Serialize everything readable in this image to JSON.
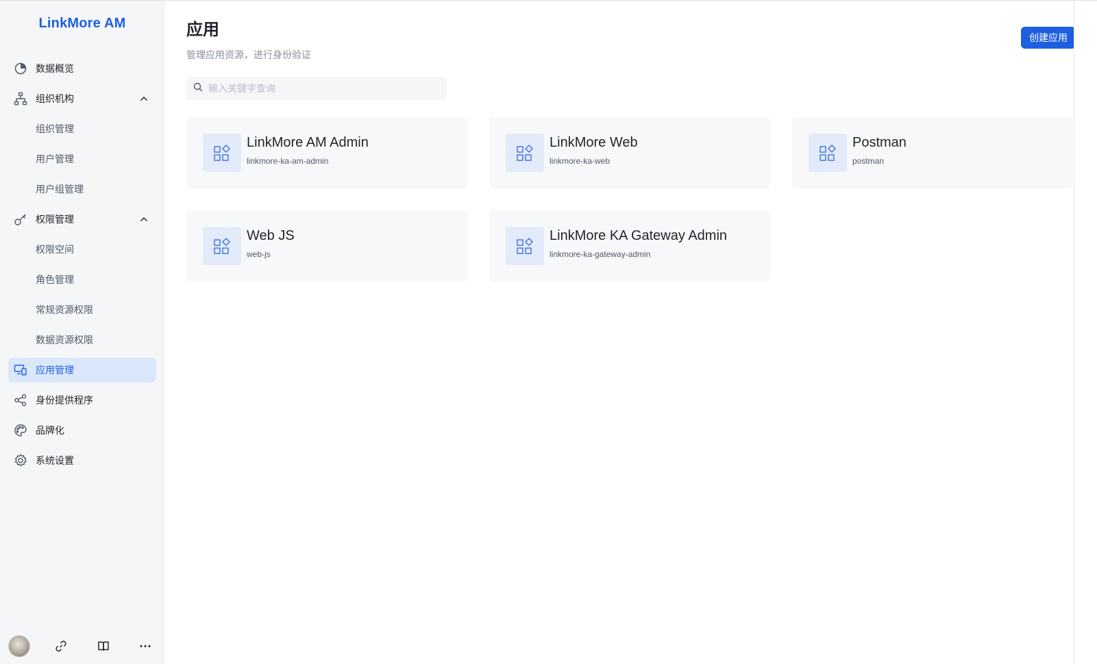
{
  "brand": "LinkMore AM",
  "nav": [
    {
      "label": "数据概览",
      "icon": "pie-chart-icon",
      "level": 0
    },
    {
      "label": "组织机构",
      "icon": "org-tree-icon",
      "level": 0,
      "expanded": true
    },
    {
      "label": "组织管理",
      "level": 1
    },
    {
      "label": "用户管理",
      "level": 1
    },
    {
      "label": "用户组管理",
      "level": 1
    },
    {
      "label": "权限管理",
      "icon": "key-icon",
      "level": 0,
      "expanded": true
    },
    {
      "label": "权限空间",
      "level": 1
    },
    {
      "label": "角色管理",
      "level": 1
    },
    {
      "label": "常规资源权限",
      "level": 1
    },
    {
      "label": "数据资源权限",
      "level": 1
    },
    {
      "label": "应用管理",
      "icon": "devices-icon",
      "level": 0,
      "active": true
    },
    {
      "label": "身份提供程序",
      "icon": "share-icon",
      "level": 0
    },
    {
      "label": "品牌化",
      "icon": "palette-icon",
      "level": 0
    },
    {
      "label": "系统设置",
      "icon": "gear-icon",
      "level": 0
    }
  ],
  "footer": {
    "icons": [
      "avatar",
      "link-icon",
      "book-icon",
      "more-icon"
    ]
  },
  "header": {
    "title": "应用",
    "subtitle": "管理应用资源，进行身份验证",
    "create_button": "创建应用"
  },
  "search": {
    "placeholder": "输入关键字查询",
    "value": ""
  },
  "apps": [
    {
      "name": "LinkMore AM Admin",
      "code": "linkmore-ka-am-admin"
    },
    {
      "name": "LinkMore Web",
      "code": "linkmore-ka-web"
    },
    {
      "name": "Postman",
      "code": "postman"
    },
    {
      "name": "Web JS",
      "code": "web-js"
    },
    {
      "name": "LinkMore KA Gateway Admin",
      "code": "linkmore-ka-gateway-admin"
    }
  ],
  "colors": {
    "accent": "#1d5fe0",
    "active_bg": "#dbe8fb",
    "sidebar_bg": "#f5f6f8",
    "card_bg": "#f7f8fa"
  }
}
